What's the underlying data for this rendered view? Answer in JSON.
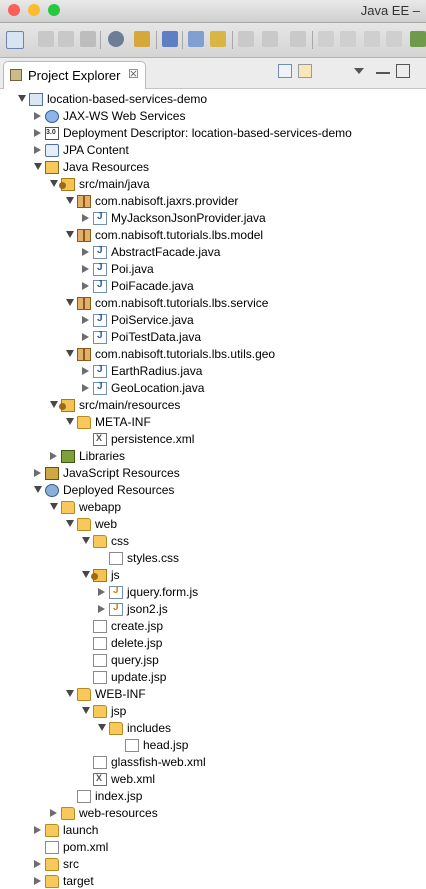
{
  "window": {
    "title": "Java EE –"
  },
  "colors": {
    "close": "#fc5f57",
    "minimize": "#fdbc2e",
    "zoom": "#28c840"
  },
  "view": {
    "tab_label": "Project Explorer",
    "close_glyph": "☒"
  },
  "tree": [
    {
      "depth": 0,
      "icon": "project",
      "twisty": "open",
      "label": "location-based-services-demo"
    },
    {
      "depth": 1,
      "icon": "webservice",
      "twisty": "closed",
      "label": "JAX-WS Web Services"
    },
    {
      "depth": 1,
      "icon": "dd",
      "twisty": "closed",
      "label": "Deployment Descriptor: location-based-services-demo"
    },
    {
      "depth": 1,
      "icon": "jpa",
      "twisty": "closed",
      "label": "JPA Content"
    },
    {
      "depth": 1,
      "icon": "jres",
      "twisty": "open",
      "label": "Java Resources"
    },
    {
      "depth": 2,
      "icon": "srcfolder",
      "twisty": "open",
      "label": "src/main/java"
    },
    {
      "depth": 3,
      "icon": "pkg",
      "twisty": "open",
      "label": "com.nabisoft.jaxrs.provider"
    },
    {
      "depth": 4,
      "icon": "javafile",
      "twisty": "closed",
      "label": "MyJacksonJsonProvider.java"
    },
    {
      "depth": 3,
      "icon": "pkg",
      "twisty": "open",
      "label": "com.nabisoft.tutorials.lbs.model"
    },
    {
      "depth": 4,
      "icon": "javafile",
      "twisty": "closed",
      "label": "AbstractFacade.java"
    },
    {
      "depth": 4,
      "icon": "javafile",
      "twisty": "closed",
      "label": "Poi.java"
    },
    {
      "depth": 4,
      "icon": "javafile",
      "twisty": "closed",
      "label": "PoiFacade.java"
    },
    {
      "depth": 3,
      "icon": "pkg",
      "twisty": "open",
      "label": "com.nabisoft.tutorials.lbs.service"
    },
    {
      "depth": 4,
      "icon": "javafile",
      "twisty": "closed",
      "label": "PoiService.java"
    },
    {
      "depth": 4,
      "icon": "javafile",
      "twisty": "closed",
      "label": "PoiTestData.java"
    },
    {
      "depth": 3,
      "icon": "pkg",
      "twisty": "open",
      "label": "com.nabisoft.tutorials.lbs.utils.geo"
    },
    {
      "depth": 4,
      "icon": "javafile",
      "twisty": "closed",
      "label": "EarthRadius.java"
    },
    {
      "depth": 4,
      "icon": "javafile",
      "twisty": "closed",
      "label": "GeoLocation.java"
    },
    {
      "depth": 2,
      "icon": "srcfolder",
      "twisty": "open",
      "label": "src/main/resources"
    },
    {
      "depth": 3,
      "icon": "folder",
      "twisty": "open",
      "label": "META-INF"
    },
    {
      "depth": 4,
      "icon": "xml",
      "twisty": "none",
      "label": "persistence.xml"
    },
    {
      "depth": 2,
      "icon": "libs",
      "twisty": "closed",
      "label": "Libraries"
    },
    {
      "depth": 1,
      "icon": "jsres",
      "twisty": "closed",
      "label": "JavaScript Resources"
    },
    {
      "depth": 1,
      "icon": "deployed",
      "twisty": "open",
      "label": "Deployed Resources"
    },
    {
      "depth": 2,
      "icon": "folder",
      "twisty": "open",
      "label": "webapp"
    },
    {
      "depth": 3,
      "icon": "folder",
      "twisty": "open",
      "label": "web"
    },
    {
      "depth": 4,
      "icon": "folder",
      "twisty": "open",
      "label": "css"
    },
    {
      "depth": 5,
      "icon": "file",
      "twisty": "none",
      "label": "styles.css"
    },
    {
      "depth": 4,
      "icon": "srcfolder",
      "twisty": "open",
      "label": "js"
    },
    {
      "depth": 5,
      "icon": "jsfile",
      "twisty": "closed",
      "label": "jquery.form.js"
    },
    {
      "depth": 5,
      "icon": "jsfile",
      "twisty": "closed",
      "label": "json2.js"
    },
    {
      "depth": 4,
      "icon": "file",
      "twisty": "none",
      "label": "create.jsp"
    },
    {
      "depth": 4,
      "icon": "file",
      "twisty": "none",
      "label": "delete.jsp"
    },
    {
      "depth": 4,
      "icon": "file",
      "twisty": "none",
      "label": "query.jsp"
    },
    {
      "depth": 4,
      "icon": "file",
      "twisty": "none",
      "label": "update.jsp"
    },
    {
      "depth": 3,
      "icon": "folder",
      "twisty": "open",
      "label": "WEB-INF"
    },
    {
      "depth": 4,
      "icon": "folder",
      "twisty": "open",
      "label": "jsp"
    },
    {
      "depth": 5,
      "icon": "folder",
      "twisty": "open",
      "label": "includes"
    },
    {
      "depth": 6,
      "icon": "file",
      "twisty": "none",
      "label": "head.jsp"
    },
    {
      "depth": 4,
      "icon": "file",
      "twisty": "none",
      "label": "glassfish-web.xml"
    },
    {
      "depth": 4,
      "icon": "xml",
      "twisty": "none",
      "label": "web.xml"
    },
    {
      "depth": 3,
      "icon": "file",
      "twisty": "none",
      "label": "index.jsp"
    },
    {
      "depth": 2,
      "icon": "folder",
      "twisty": "closed",
      "label": "web-resources"
    },
    {
      "depth": 1,
      "icon": "folder",
      "twisty": "closed",
      "label": "launch"
    },
    {
      "depth": 1,
      "icon": "file",
      "twisty": "none",
      "label": "pom.xml"
    },
    {
      "depth": 1,
      "icon": "folder",
      "twisty": "closed",
      "label": "src"
    },
    {
      "depth": 1,
      "icon": "folder",
      "twisty": "closed",
      "label": "target"
    }
  ]
}
